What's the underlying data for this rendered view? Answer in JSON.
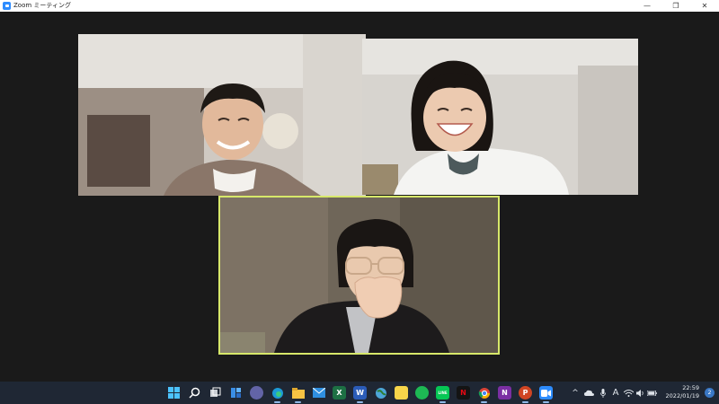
{
  "window": {
    "title": "Zoom ミーティング",
    "controls": {
      "minimize": "—",
      "maximize": "❐",
      "close": "✕"
    }
  },
  "participants": [
    {
      "id": "participant-1",
      "active_speaker": false
    },
    {
      "id": "participant-2",
      "active_speaker": false
    },
    {
      "id": "participant-3",
      "active_speaker": true
    }
  ],
  "taskbar": {
    "apps": [
      {
        "name": "start-icon",
        "glyph": ""
      },
      {
        "name": "search-icon",
        "glyph": ""
      },
      {
        "name": "task-view-icon",
        "glyph": ""
      },
      {
        "name": "widgets-icon",
        "glyph": ""
      },
      {
        "name": "teams-chat-icon",
        "glyph": ""
      },
      {
        "name": "edge-icon",
        "glyph": ""
      },
      {
        "name": "file-explorer-icon",
        "glyph": ""
      },
      {
        "name": "mail-icon",
        "glyph": ""
      },
      {
        "name": "excel-icon",
        "glyph": "X"
      },
      {
        "name": "word-icon",
        "glyph": "W"
      },
      {
        "name": "globe-app-icon",
        "glyph": ""
      },
      {
        "name": "sticky-notes-icon",
        "glyph": ""
      },
      {
        "name": "spotify-icon",
        "glyph": ""
      },
      {
        "name": "line-icon",
        "glyph": "LINE"
      },
      {
        "name": "netflix-icon",
        "glyph": "N"
      },
      {
        "name": "chrome-icon",
        "glyph": ""
      },
      {
        "name": "onenote-icon",
        "glyph": "N"
      },
      {
        "name": "powerpoint-icon",
        "glyph": "P"
      },
      {
        "name": "zoom-icon",
        "glyph": ""
      }
    ],
    "tray": {
      "chevron": "^",
      "ime": "A",
      "time": "22:59",
      "date": "2022/01/19",
      "notifications": "2"
    }
  },
  "colors": {
    "background": "#1a1a1a",
    "active_speaker_border": "#d7e86a",
    "taskbar": "#1f2734",
    "zoom_blue": "#2d8cff"
  }
}
